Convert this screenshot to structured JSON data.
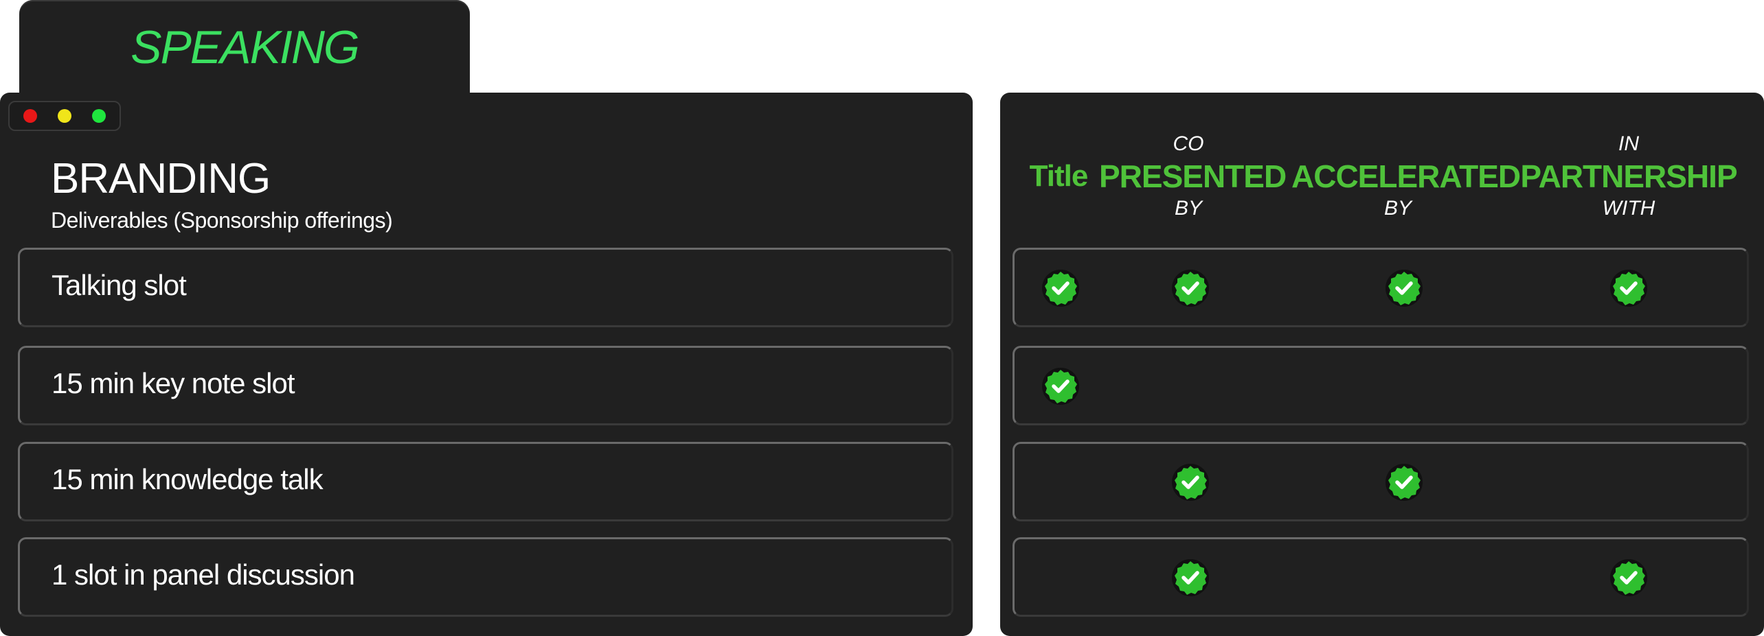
{
  "tab": {
    "title": "SPEAKING"
  },
  "left_panel": {
    "title": "BRANDING",
    "subtitle": "Deliverables (Sponsorship offerings)",
    "rows": [
      "Talking slot",
      "15 min key note slot",
      "15 min knowledge talk",
      "1 slot in panel discussion"
    ]
  },
  "right_panel": {
    "columns": [
      {
        "top": "",
        "main": "Title",
        "bottom": ""
      },
      {
        "top": "CO",
        "main": "PRESENTED",
        "bottom": "BY"
      },
      {
        "top": "",
        "main": "ACCELERATED",
        "bottom": "BY"
      },
      {
        "top": "IN",
        "main": "PARTNERSHIP",
        "bottom": "WITH"
      }
    ],
    "matrix": [
      [
        true,
        true,
        true,
        true
      ],
      [
        true,
        false,
        false,
        false
      ],
      [
        false,
        true,
        true,
        false
      ],
      [
        false,
        true,
        false,
        true
      ]
    ]
  },
  "colors": {
    "accent_green": "#3be060",
    "header_green": "#4fc23a",
    "panel_bg": "#202020",
    "check_green": "#2fbf2f"
  },
  "icons": {
    "check": "check-badge-icon",
    "window_controls": [
      "close-dot-icon",
      "minimize-dot-icon",
      "maximize-dot-icon"
    ]
  }
}
